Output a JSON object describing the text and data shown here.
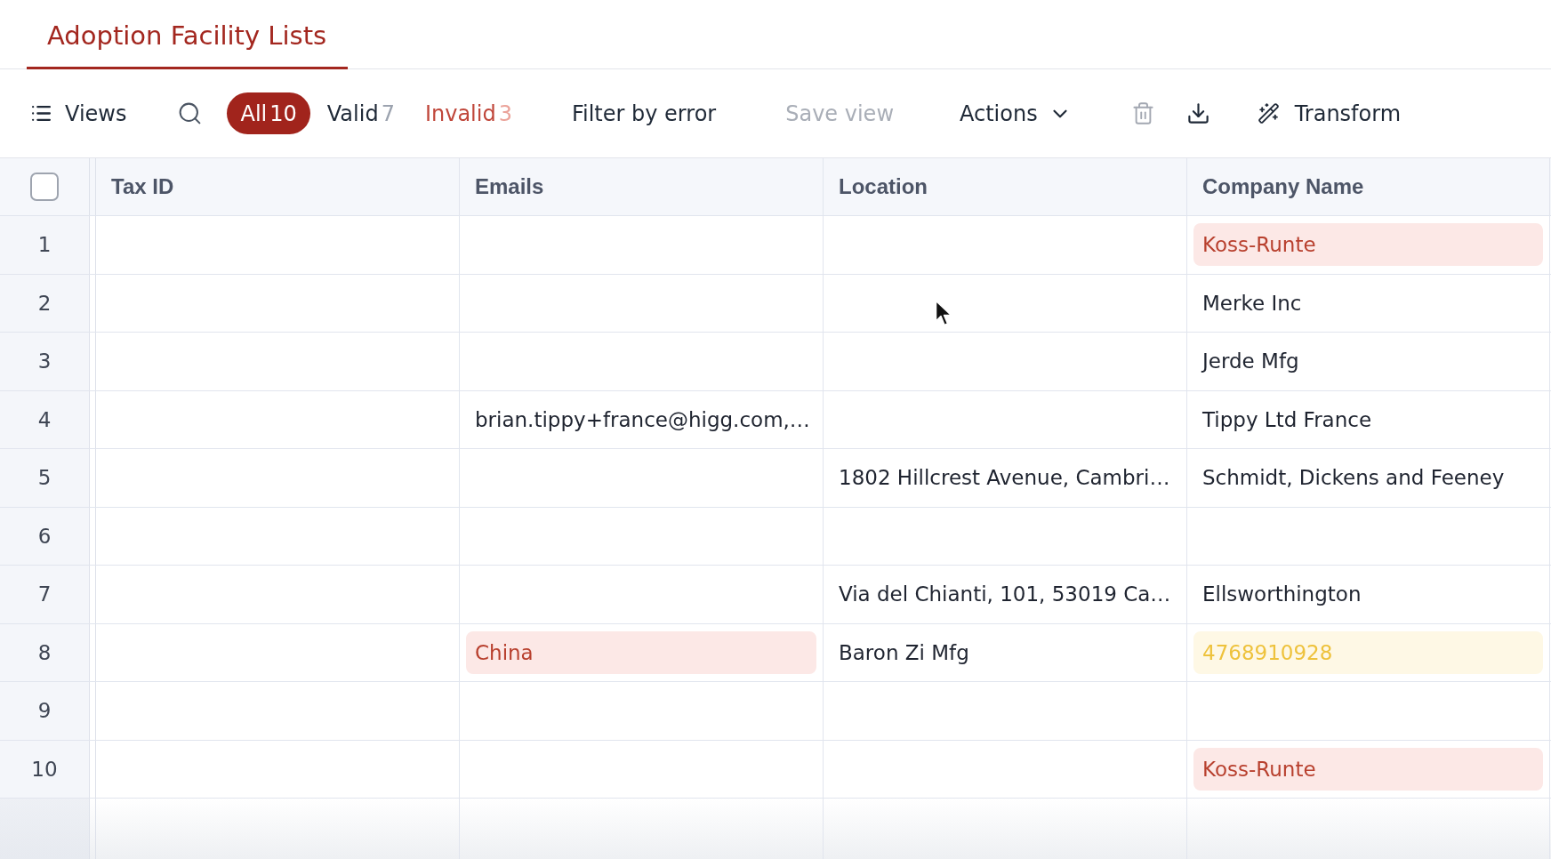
{
  "tabs": [
    {
      "label": "Adoption Facility Lists",
      "selected": true
    }
  ],
  "toolbar": {
    "views": {
      "label": "Views"
    },
    "filters": [
      {
        "kind": "all",
        "label": "All",
        "count": "10",
        "selected": true
      },
      {
        "kind": "valid",
        "label": "Valid",
        "count": "7",
        "selected": false
      },
      {
        "kind": "invalid",
        "label": "Invalid",
        "count": "3",
        "selected": false
      }
    ],
    "buttons": [
      {
        "label": "Filter by error",
        "disabled": false
      },
      {
        "label": "Save view",
        "disabled": true
      }
    ],
    "actions": {
      "label": "Actions"
    },
    "icon_buttons": [
      {
        "kind": "delete",
        "disabled": true
      },
      {
        "kind": "download",
        "disabled": false
      }
    ],
    "transform": {
      "label": "Transform"
    }
  },
  "table": {
    "select_all": {
      "checked": false
    },
    "columns": [
      "Tax ID",
      "Emails",
      "Location",
      "Company Name"
    ],
    "rows": [
      {
        "number": "1",
        "company_name": {
          "text": "Koss-Runte",
          "error": true,
          "warning": false
        }
      },
      {
        "number": "2",
        "company_name": {
          "text": "Merke Inc",
          "error": false,
          "warning": false
        }
      },
      {
        "number": "3",
        "company_name": {
          "text": "Jerde Mfg",
          "error": false,
          "warning": false
        }
      },
      {
        "number": "4",
        "emails": {
          "text": "brian.tippy+france@higg.com,…",
          "error": false,
          "warning": false
        },
        "company_name": {
          "text": "Tippy Ltd France",
          "error": false,
          "warning": false
        }
      },
      {
        "number": "5",
        "location": {
          "text": "1802 Hillcrest Avenue, Cambri…",
          "error": false,
          "warning": false
        },
        "company_name": {
          "text": "Schmidt, Dickens and Feeney",
          "error": false,
          "warning": false
        }
      },
      {
        "number": "6"
      },
      {
        "number": "7",
        "location": {
          "text": "Via del Chianti, 101, 53019 Ca…",
          "error": false,
          "warning": false
        },
        "company_name": {
          "text": "Ellsworthington",
          "error": false,
          "warning": false
        }
      },
      {
        "number": "8",
        "emails": {
          "text": "China",
          "error": true,
          "warning": false
        },
        "location": {
          "text": "Baron Zi Mfg",
          "error": false,
          "warning": false
        },
        "company_name": {
          "text": "4768910928",
          "error": false,
          "warning": true
        }
      },
      {
        "number": "9"
      },
      {
        "number": "10",
        "company_name": {
          "text": "Koss-Runte",
          "error": true,
          "warning": false
        }
      }
    ]
  }
}
